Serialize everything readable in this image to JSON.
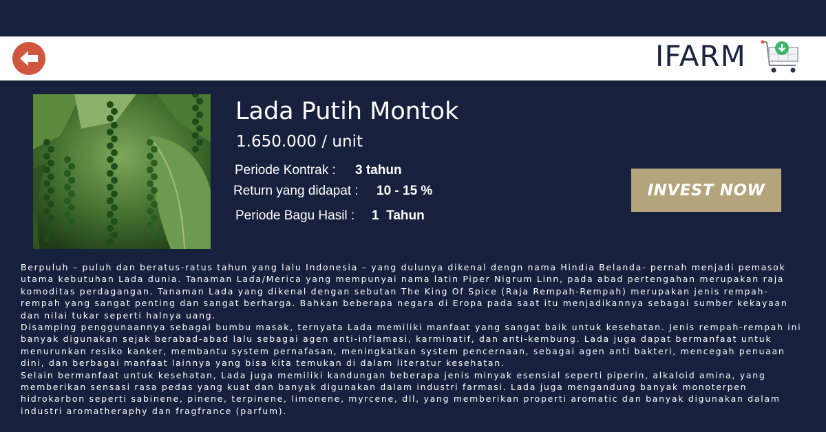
{
  "header": {
    "logo_text": "IFARM",
    "back_icon": "arrow-left-icon",
    "cart_icon": "cart-download-icon"
  },
  "product": {
    "image_icon": "pepper-plant-photo",
    "title": "Lada Putih Montok",
    "price": "1.650.000 / unit",
    "details": [
      {
        "label": "Periode Kontrak :",
        "value": "3 tahun"
      },
      {
        "label": "Return yang didapat :",
        "value": "10 - 15 %"
      },
      {
        "label": "Periode Bagu Hasil :",
        "value": "1  Tahun"
      }
    ],
    "invest_label": "INVEST NOW"
  },
  "description": {
    "paragraphs": [
      "Berpuluh – puluh dan beratus-ratus tahun yang lalu Indonesia – yang dulunya dikenal dengn nama Hindia Belanda- pernah menjadi pemasok utama kebutuhan Lada dunia. Tanaman Lada/Merica yang mempunyai nama latin Piper Nigrum Linn, pada abad pertengahan merupakan raja komoditas perdagangan.  Tanaman Lada yang dikenal dengan sebutan The King Of Spice (Raja Rempah-Rempah) merupakan jenis rempah-rempah yang sangat penting dan sangat berharga. Bahkan beberapa negara di Eropa pada saat itu menjadikannya sebagai sumber kekayaan dan nilai tukar seperti halnya uang.",
      "Disamping penggunaannya sebagai bumbu masak, ternyata Lada memiliki manfaat yang sangat baik untuk kesehatan. Jenis rempah-rempah ini banyak digunakan sejak berabad-abad lalu sebagai agen anti-inflamasi, karminatif, dan anti-kembung. Lada juga dapat bermanfaat untuk menurunkan resiko kanker, membantu system pernafasan, meningkatkan system pencernaan, sebagai agen anti bakteri, mencegah penuaan dini, dan berbagai manfaat lainnya yang bisa kita temukan di dalam literatur kesehatan.",
      "Selain bermanfaat untuk kesehatan, Lada juga memiliki kandungan beberapa jenis minyak esensial seperti piperin, alkaloid amina, yang memberikan sensasi rasa pedas yang kuat dan banyak digunakan dalam industri farmasi. Lada juga mengandung banyak monoterpen hidrokarbon seperti sabinene, pinene, terpinene, limonene, myrcene, dll, yang memberikan properti aromatic dan banyak digunakan dalam industri aromatheraphy dan fragfrance (parfum)."
    ]
  },
  "colors": {
    "background": "#17213e",
    "header_bg": "#ffffff",
    "back_button": "#d0573f",
    "invest_button": "#b3a47c",
    "cart_badge": "#3fb36b"
  }
}
